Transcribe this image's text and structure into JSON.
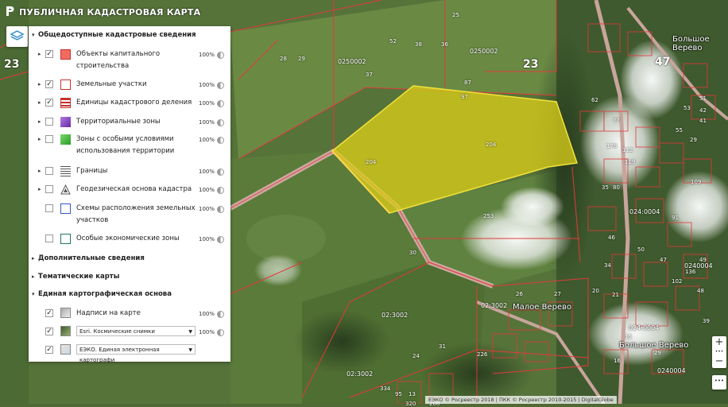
{
  "app": {
    "title": "ПУБЛИЧНАЯ КАДАСТРОВАЯ КАРТА"
  },
  "map": {
    "big_labels": [
      "23",
      "23",
      "47"
    ],
    "labels": [
      "38",
      "36",
      "29",
      "25",
      "37",
      "87",
      "52",
      "97",
      "28",
      "204",
      "204",
      "253",
      "62",
      "77",
      "35",
      "80",
      "27",
      "26",
      "3",
      "20",
      "21",
      "46",
      "50",
      "47",
      "49",
      "48",
      "102",
      "178",
      "119",
      "34",
      "29",
      "112",
      "226",
      "24",
      "31",
      "95",
      "13",
      "30",
      "39",
      "208",
      "136",
      "109",
      "55",
      "53",
      "51",
      "42",
      "41",
      "91",
      "16",
      "334",
      "320",
      "15",
      "29"
    ],
    "quarter_labels": [
      "0250002",
      "0250002",
      "024:0004",
      "0240004",
      "0240004",
      "024:0004",
      "02:3002",
      "02:3002",
      "02:3002"
    ],
    "place_names": [
      "Большое Верево",
      "Малое Верево",
      "Большое Верево"
    ],
    "parcel_highlight_color": "#d7cc1a"
  },
  "panel": {
    "sections": {
      "public": "Общедоступные кадастровые сведения",
      "additional": "Дополнительные сведения",
      "thematic": "Тематические карты",
      "basemap": "Единая картографическая основа"
    },
    "layers": [
      {
        "label": "Объекты капитального строительства",
        "checked": true,
        "percent": "100%",
        "swatch": "#e8413a"
      },
      {
        "label": "Земельные участки",
        "checked": true,
        "percent": "100%",
        "swatch": "#c8312b"
      },
      {
        "label": "Единицы кадастрового деления",
        "checked": true,
        "percent": "100%",
        "swatch": "#c8312b"
      },
      {
        "label": "Территориальные зоны",
        "checked": false,
        "percent": "100%",
        "swatch": "#8a3fc4"
      },
      {
        "label": "Зоны с особыми условиями использования территории",
        "checked": false,
        "percent": "100%",
        "swatch": "#3aa83a"
      },
      {
        "label": "Границы",
        "checked": false,
        "percent": "100%",
        "swatch": "#555555"
      },
      {
        "label": "Геодезическая основа кадастра",
        "checked": false,
        "percent": "100%",
        "swatch": "#555555"
      },
      {
        "label": "Схемы расположения земельных участков",
        "checked": false,
        "percent": "100%",
        "swatch": "#3458c8"
      },
      {
        "label": "Особые экономические зоны",
        "checked": false,
        "percent": "100%",
        "swatch": "#1e7a5a"
      }
    ],
    "basemap_layers": [
      {
        "label": "Надписи на карте",
        "checked": true,
        "percent": "100%"
      },
      {
        "select": "Esri. Космические снимки",
        "checked": true,
        "percent": "100%"
      },
      {
        "select": "ЕЭКО. Единая электронная картографи",
        "checked": true
      }
    ]
  },
  "zoom": {
    "plus": "+",
    "minus": "−",
    "dots": "•••"
  },
  "attribution": "ЕЭКО © Росреестр 2018 | ПКК © Росреестр 2010-2015 | DigitalGlobe"
}
